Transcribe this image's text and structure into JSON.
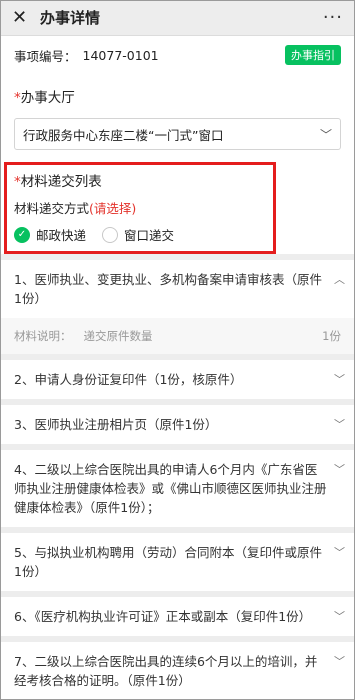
{
  "header": {
    "close_icon": "close-icon",
    "title": "办事详情",
    "more": "···"
  },
  "item": {
    "id_label": "事项编号：",
    "id_value": "14077-0101",
    "guide": "办事指引"
  },
  "hall": {
    "required_mark": "*",
    "label": "办事大厅",
    "selected": "行政服务中心东座二楼“一门式”窗口"
  },
  "materials": {
    "required_mark": "*",
    "title": "材料递交列表",
    "method_label": "材料递交方式",
    "method_hint": "(请选择)",
    "options": [
      {
        "label": "邮政快递",
        "selected": true
      },
      {
        "label": "窗口递交",
        "selected": false
      }
    ]
  },
  "list": {
    "items": [
      "1、医师执业、变更执业、多机构备案申请审核表（原件1份）",
      "2、申请人身份证复印件（1份，核原件）",
      "3、医师执业注册相片页（原件1份）",
      "4、二级以上综合医院出具的申请人6个月内《广东省医师执业注册健康体检表》或《佛山市顺德区医师执业注册健康体检表》（原件1份）；",
      "5、与拟执业机构聘用（劳动）合同附本（复印件或原件1份）",
      "6、《医疗机构执业许可证》正本或副本（复印件1份）",
      "7、二级以上综合医院出具的连续6个月以上的培训，并经考核合格的证明。（原件1份）"
    ],
    "expanded": {
      "label": "材料说明：",
      "desc": "递交原件数量",
      "count": "1份"
    }
  },
  "colors": {
    "accent": "#07c160",
    "required": "#e3322b",
    "highlight_frame": "#e41d1d"
  }
}
